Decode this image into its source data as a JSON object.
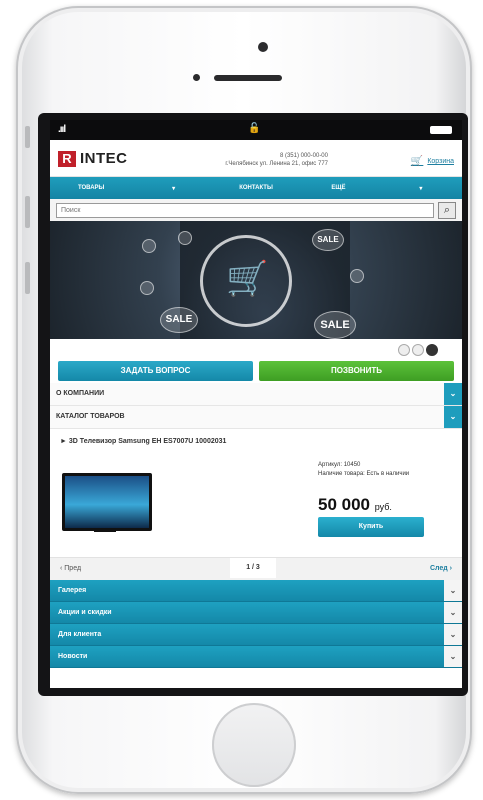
{
  "status": {
    "signal": ".ııl",
    "lock": "🔓"
  },
  "header": {
    "logo_mark": "R",
    "logo_text": "INTEC",
    "contact_phone": "8 (351) 000-00-00",
    "contact_address": "г.Челябинск ул. Ленина 21, офис 777",
    "cart_label": "Корзина"
  },
  "topnav": {
    "items": [
      "ТОВАРЫ",
      "▾",
      "КОНТАКТЫ",
      "ЕЩЁ",
      "▾"
    ]
  },
  "search": {
    "placeholder": "Поиск"
  },
  "banner": {
    "sale": "SALE"
  },
  "cta": {
    "ask_label": "ЗАДАТЬ ВОПРОС",
    "call_label": "ПОЗВОНИТЬ"
  },
  "accordion": {
    "about": "О КОМПАНИИ",
    "catalog": "КАТАЛОГ ТОВАРОВ"
  },
  "product": {
    "title": "► 3D Телевизор Samsung EH ES7007U 10002031",
    "article": "Артикул: 10450",
    "stock": "Наличие товара: Есть в наличии",
    "price": "50 000",
    "currency": "руб.",
    "buy_label": "Купить"
  },
  "pager": {
    "prev": "‹ Пред",
    "count": "1 / 3",
    "next": "След ›"
  },
  "footer_sections": [
    "Галерея",
    "Акции и скидки",
    "Для клиента",
    "Новости"
  ]
}
